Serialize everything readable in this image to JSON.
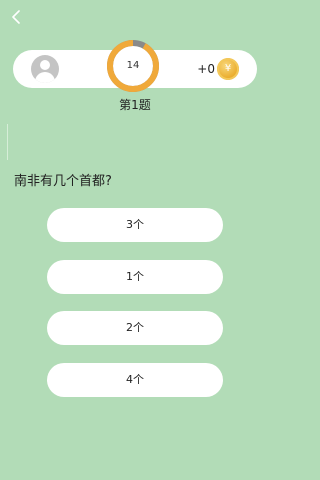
{
  "header": {
    "back_icon": "chevron-left-icon"
  },
  "score_bar": {
    "avatar_icon": "user-avatar-icon",
    "timer_value": "14",
    "timer_progress": 0.92,
    "timer_color": "#f0a93a",
    "timer_track_color": "#8a8a8a",
    "coin_delta": "+0",
    "coin_icon": "yen-coin-icon",
    "coin_symbol": "¥"
  },
  "question": {
    "number_label": "第1题",
    "text": "南非有几个首都?"
  },
  "options": [
    {
      "label": "3个"
    },
    {
      "label": "1个"
    },
    {
      "label": "2个"
    },
    {
      "label": "4个"
    }
  ],
  "colors": {
    "background": "#b2dcb7",
    "card": "#ffffff"
  }
}
